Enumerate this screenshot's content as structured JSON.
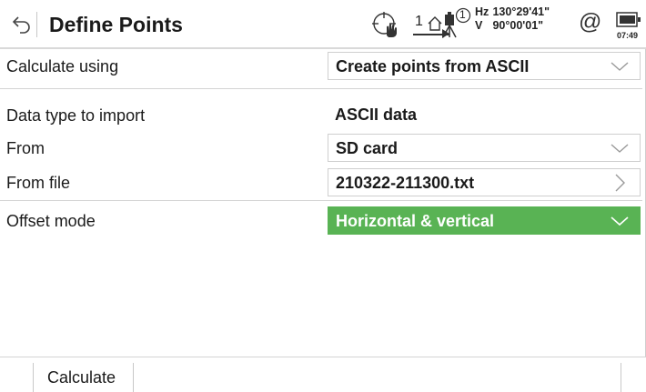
{
  "header": {
    "title": "Define Points",
    "hz_label": "Hz",
    "hz_value": "130°29'41\"",
    "v_label": "V",
    "v_value": "90°00'01\"",
    "face_indicator": "1",
    "prism_indicator": "1",
    "at_symbol": "@",
    "time": "07:49"
  },
  "form": {
    "calculate_using": {
      "label": "Calculate using",
      "value": "Create points from ASCII"
    },
    "data_type": {
      "label": "Data type to import",
      "value": "ASCII data"
    },
    "from": {
      "label": "From",
      "value": "SD card"
    },
    "from_file": {
      "label": "From file",
      "value": "210322-211300.txt"
    },
    "offset_mode": {
      "label": "Offset mode",
      "value": "Horizontal & vertical"
    }
  },
  "softkeys": {
    "f1": "Calculate"
  },
  "colors": {
    "accent_green": "#59b354",
    "text": "#1a1a1a",
    "divider": "#d4d4d4"
  },
  "icons": [
    "back-arrow-icon",
    "target-hand-icon",
    "face-house-icon",
    "prism-instrument-icon",
    "battery-icon",
    "chevron-down-icon",
    "chevron-right-icon"
  ]
}
